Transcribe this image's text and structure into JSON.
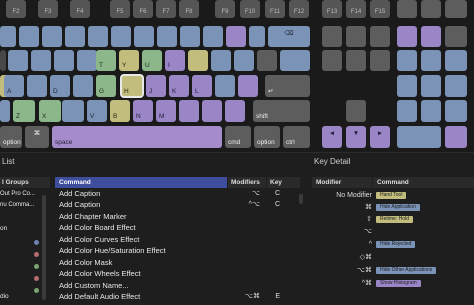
{
  "fkeys": [
    "F2",
    "F3",
    "F4",
    "F5",
    "F6",
    "F7",
    "F8",
    "F9",
    "F10",
    "F11",
    "F12",
    "F13",
    "F14",
    "F15"
  ],
  "keys": {
    "delete": "⌫",
    "t": "T",
    "y": "Y",
    "u": "U",
    "i": "I",
    "a": "A",
    "d": "D",
    "g": "G",
    "h": "H",
    "j": "J",
    "k": "K",
    "l": "L",
    "return": "↵",
    "z": "Z",
    "x": "X",
    "v": "V",
    "b": "B",
    "n": "N",
    "m": "M",
    "shift": "shift",
    "option": "option",
    "command": "⌘",
    "space": "space",
    "cmd": "cmd",
    "option_r": "option",
    "ctrl": "ctrl",
    "arrow_left": "◄",
    "arrow_down": "▼",
    "arrow_right": "►",
    "fn_r": "⌥"
  },
  "left_panel": {
    "title_partial": "List",
    "groups_header": "l Groups",
    "command_header": "Command",
    "modifiers_header": "Modifiers",
    "key_header": "Key",
    "groups": [
      "Out Pro Co...",
      "nu Comma...",
      "",
      "on",
      "",
      "",
      "",
      "",
      "",
      "",
      "dio"
    ],
    "commands": [
      {
        "name": "Add Caption",
        "mod": "⌥",
        "key": "C"
      },
      {
        "name": "Add Caption",
        "mod": "^⌥",
        "key": "C"
      },
      {
        "name": "Add Chapter Marker",
        "mod": "",
        "key": ""
      },
      {
        "name": "Add Color Board Effect",
        "mod": "",
        "key": ""
      },
      {
        "name": "Add Color Curves Effect",
        "mod": "",
        "key": ""
      },
      {
        "name": "Add Color Hue/Saturation Effect",
        "mod": "",
        "key": ""
      },
      {
        "name": "Add Color Mask",
        "mod": "",
        "key": ""
      },
      {
        "name": "Add Color Wheels Effect",
        "mod": "",
        "key": ""
      },
      {
        "name": "Add Custom Name...",
        "mod": "",
        "key": ""
      },
      {
        "name": "Add Default Audio Effect",
        "mod": "⌥⌘",
        "key": "E"
      }
    ]
  },
  "key_detail": {
    "title": "Key Detail",
    "modifier_header": "Modifier",
    "command_header": "Command",
    "rows": [
      {
        "mod": "No Modifier",
        "cmd": "Hand Tool",
        "color": "#c2bd7c"
      },
      {
        "mod": "⌘",
        "cmd": "Hide Application",
        "color": "#7c93b8"
      },
      {
        "mod": "⇧",
        "cmd": "Retime: Hold",
        "color": "#c2bd7c"
      },
      {
        "mod": "⌥",
        "cmd": "",
        "color": ""
      },
      {
        "mod": "^",
        "cmd": "Hide Rejected",
        "color": "#7c93b8"
      },
      {
        "mod": "◇⌘",
        "cmd": "",
        "color": ""
      },
      {
        "mod": "⌥⌘",
        "cmd": "Hide Other Applications",
        "color": "#7c93b8"
      },
      {
        "mod": "^⌘",
        "cmd": "Show Histogram",
        "color": "#9a86c6"
      }
    ]
  }
}
